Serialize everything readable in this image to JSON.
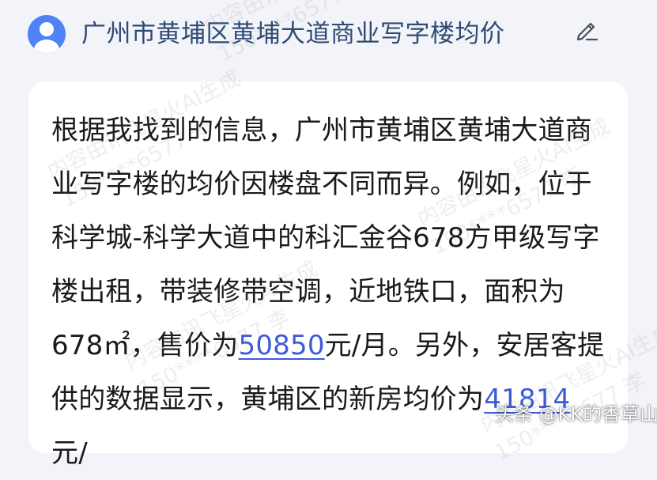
{
  "query": {
    "text": "广州市黄埔区黄埔大道商业写字楼均价"
  },
  "answer": {
    "part1": "根据我找到的信息，广州市黄埔区黄埔大道商业写字楼的均价因楼盘不同而异。例如，位于科学城-科学大道中的科汇金谷678方甲级写字楼出租，带装修带空调，近地铁口，面积为678㎡，售价为",
    "link1": "50850",
    "part2": "元/月。另外，安居客提供的数据显示，黄埔区的新房均价为",
    "link2": "41814",
    "part3": "元/"
  },
  "watermark": {
    "line1": "内容由讯飞星火AI生成",
    "line2": "150****6577 李"
  },
  "footer": {
    "credit": "头条 @KK的香草山"
  },
  "colors": {
    "background": "#f3f4f9",
    "avatar": "#4f82f4",
    "query_text": "#2f4a74",
    "link": "#3d5bd6",
    "card": "#ffffff"
  },
  "icons": {
    "avatar": "user-avatar-icon",
    "edit": "pencil-edit-icon"
  }
}
